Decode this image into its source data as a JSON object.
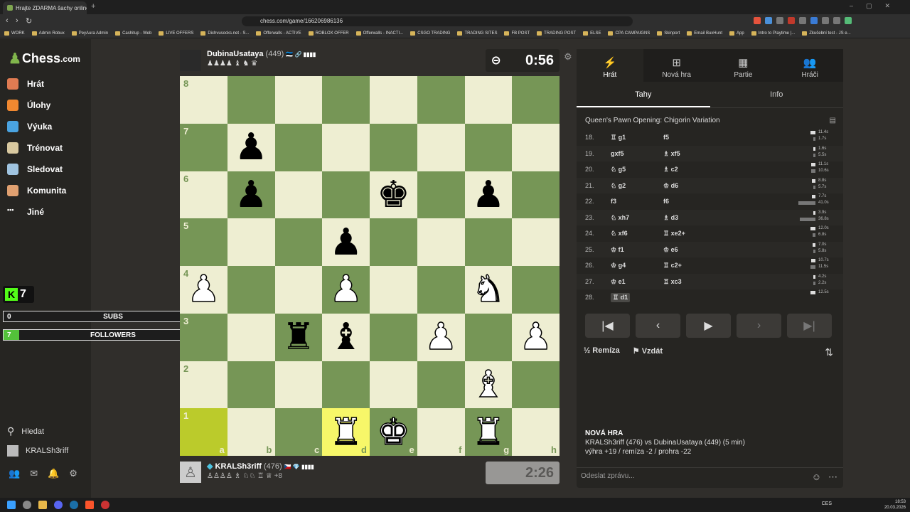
{
  "browser": {
    "tab_title": "Hrajte ZDARMA šachy online - Š...",
    "url": "chess.com/game/166206986136",
    "bookmarks": [
      "WORK",
      "Admin Robux",
      "PeyAura Admin",
      "Cashitup - Web",
      "LIVE OFFERS",
      "Dichvusocks.net - S...",
      "Offerwalls - ACTIVE",
      "ROBLOX OFFER",
      "Offerwalls - INACTI...",
      "CSGO TRADING",
      "TRADING SITES",
      "FB POST",
      "TRADING POST",
      "ELSE",
      "CPA CAMPAIGNS",
      "Skinport",
      "Email BuxHunt",
      "App",
      "Intro to Playtime |...",
      "Zkušební test - JS e..."
    ]
  },
  "sidebar": {
    "logo": "Chess",
    "logo_domain": ".com",
    "items": [
      {
        "label": "Hrát",
        "color": "#e07b52"
      },
      {
        "label": "Úlohy",
        "color": "#f08830"
      },
      {
        "label": "Výuka",
        "color": "#4aa3e0"
      },
      {
        "label": "Trénovat",
        "color": "#d9c9a0"
      },
      {
        "label": "Sledovat",
        "color": "#a0c4e0"
      },
      {
        "label": "Komunita",
        "color": "#e0a070"
      },
      {
        "label": "Jiné",
        "color": "#ffffff"
      }
    ],
    "search_label": "Hledat",
    "user_label": "KRALSh3riff"
  },
  "overlay": {
    "kick_count": "7",
    "subs": {
      "current": "0",
      "label": "SUBS",
      "target": "10",
      "progress": 0.0
    },
    "followers": {
      "current": "7",
      "label": "FOLLOWERS",
      "target": "100",
      "progress": 0.07
    }
  },
  "top_player": {
    "name": "DubinaUsataya",
    "rating": "(449)",
    "flags": "🇪🇪 🔗 ▮▮▮▮",
    "captured": "♟♟♟♟ ♝ ♞ ♛",
    "clock": "0:56"
  },
  "bottom_player": {
    "name": "KRALSh3riff",
    "rating": "(476)",
    "flags": "🇨🇿 💎 ▮▮▮▮",
    "captured": "♙♙♙♙ ♗ ♘♘ ♖ ♕",
    "advantage": "+8",
    "clock": "2:26"
  },
  "board": {
    "files": [
      "a",
      "b",
      "c",
      "d",
      "e",
      "f",
      "g",
      "h"
    ],
    "ranks": [
      "8",
      "7",
      "6",
      "5",
      "4",
      "3",
      "2",
      "1"
    ],
    "light_color": "#eeeed2",
    "dark_color": "#769656",
    "highlight_light": "#f7f769",
    "highlight_dark": "#bbcb2b",
    "highlighted": [
      "a1",
      "d1"
    ],
    "pieces": {
      "b7": "bp",
      "b6": "bp",
      "e6": "bk",
      "g6": "bp",
      "d5": "bp",
      "a4": "wp",
      "d4": "wp",
      "g4": "wn",
      "c3": "br",
      "d3": "bb",
      "f3": "wp",
      "h3": "wp",
      "g2": "wb",
      "d1": "wr",
      "e1": "wk",
      "g1": "wr"
    }
  },
  "panel": {
    "tabs": [
      {
        "label": "Hrát",
        "icon": "bolt-icon"
      },
      {
        "label": "Nová hra",
        "icon": "plus-icon"
      },
      {
        "label": "Partie",
        "icon": "board-icon"
      },
      {
        "label": "Hráči",
        "icon": "players-icon"
      }
    ],
    "subtabs": [
      "Tahy",
      "Info"
    ],
    "opening": "Queen's Pawn Opening: Chigorin Variation",
    "moves": [
      {
        "n": "18.",
        "w": "♖ g1",
        "b": "f5",
        "wt": "11.4s",
        "bt": "1.7s",
        "wv": 11.4,
        "bv": 1.7
      },
      {
        "n": "19.",
        "w": "gxf5",
        "b": "♗ xf5",
        "wt": "1.6s",
        "bt": "5.5s",
        "wv": 1.6,
        "bv": 5.5
      },
      {
        "n": "20.",
        "w": "♘ g5",
        "b": "♗ c2",
        "wt": "11.1s",
        "bt": "10.6s",
        "wv": 11.1,
        "bv": 10.6
      },
      {
        "n": "21.",
        "w": "♘ g2",
        "b": "♔ d6",
        "wt": "8.8s",
        "bt": "5.7s",
        "wv": 8.8,
        "bv": 5.7
      },
      {
        "n": "22.",
        "w": "f3",
        "b": "f6",
        "wt": "7.7s",
        "bt": "41.0s",
        "wv": 7.7,
        "bv": 41.0
      },
      {
        "n": "23.",
        "w": "♘ xh7",
        "b": "♗ d3",
        "wt": "3.9s",
        "bt": "36.8s",
        "wv": 3.9,
        "bv": 36.8
      },
      {
        "n": "24.",
        "w": "♘ xf6",
        "b": "♖ xe2+",
        "wt": "12.0s",
        "bt": "6.8s",
        "wv": 12.0,
        "bv": 6.8
      },
      {
        "n": "25.",
        "w": "♔ f1",
        "b": "♔ e6",
        "wt": "7.0s",
        "bt": "5.8s",
        "wv": 7.0,
        "bv": 5.8
      },
      {
        "n": "26.",
        "w": "♔ g4",
        "b": "♖ c2+",
        "wt": "10.7s",
        "bt": "11.5s",
        "wv": 10.7,
        "bv": 11.5
      },
      {
        "n": "27.",
        "w": "♔ e1",
        "b": "♖ xc3",
        "wt": "4.2s",
        "bt": "2.2s",
        "wv": 4.2,
        "bv": 2.2
      },
      {
        "n": "28.",
        "w": "♖ d1",
        "b": "",
        "wt": "12.5s",
        "bt": "",
        "wv": 12.5,
        "bv": 0
      }
    ],
    "draw_label": "Remíza",
    "resign_label": "Vzdát",
    "new_game_title": "NOVÁ HRA",
    "new_game_line": "KRALSh3riff (476) vs DubinaUsataya (449) (5 min)",
    "new_game_stats": "výhra +19 / remíza -2 / prohra -22",
    "chat_placeholder": "Odeslat zprávu..."
  },
  "taskbar": {
    "lang": "CES",
    "time": "18:53",
    "date": "20.03.2026"
  }
}
